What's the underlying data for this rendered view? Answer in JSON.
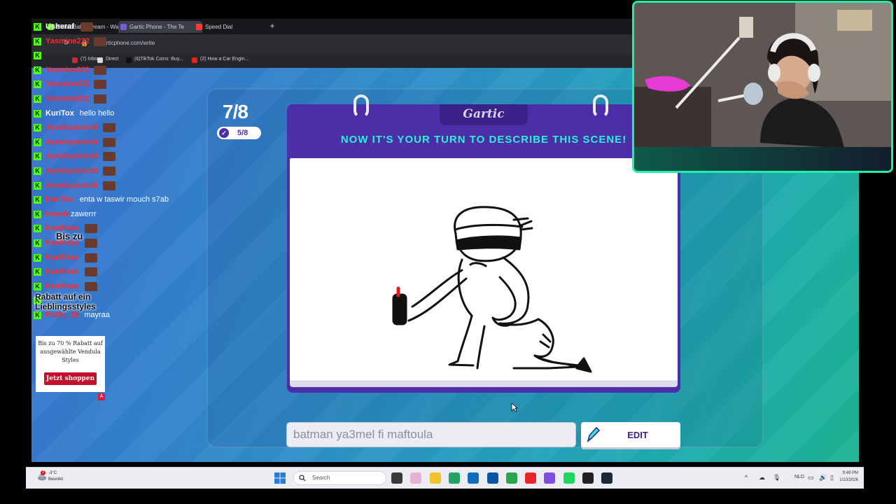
{
  "browser": {
    "tabs": [
      {
        "label": "EvilishBaby Stream - Watc",
        "color": "#53fc18",
        "active": false
      },
      {
        "label": "Gartic Phone - The Te",
        "color": "#7b5bd6",
        "active": true
      },
      {
        "label": "Speed Dial",
        "color": "#ff3b3b",
        "active": false
      }
    ],
    "new_tab": "+",
    "url": "garticphone.com/write",
    "bookmarks": [
      {
        "label": "(7) Inbox",
        "color": "#c03030"
      },
      {
        "label": "Direct",
        "color": "#d9d9d9"
      },
      {
        "label": "(6)TikTok Coins: Buy...",
        "color": "#111111"
      },
      {
        "label": "(2) How a Car Engin...",
        "color": "#e62117"
      }
    ]
  },
  "game": {
    "round": "7/8",
    "done_count": "5/8",
    "logo": "Gartic",
    "prompt": "NOW IT'S YOUR TURN TO DESCRIBE THIS SCENE!",
    "answer": "batman ya3mel fi maftoula",
    "edit_label": "EDIT",
    "brand_color": "#4b2ea8",
    "prompt_color": "#2ef0d8"
  },
  "chat": {
    "messages": [
      {
        "user": "Usheraf",
        "color": "#ffffff",
        "text": "",
        "emotes": 1
      },
      {
        "user": "Yasmine222",
        "color": "#ff2a2a",
        "text": "",
        "emotes": 1
      },
      {
        "user": "",
        "color": "#ff2a2a",
        "text": "",
        "emotes": 0
      },
      {
        "user": "Yasmine222",
        "color": "#ff2a2a",
        "text": "",
        "emotes": 1
      },
      {
        "user": "Yasmine222",
        "color": "#ff2a2a",
        "text": "",
        "emotes": 1
      },
      {
        "user": "Yasmine222",
        "color": "#ff2a2a",
        "text": "",
        "emotes": 1
      },
      {
        "user": "KuriTox",
        "color": "#ffffff",
        "text": "hello hello",
        "emotes": 0
      },
      {
        "user": "Ayoubyacoubi",
        "color": "#ff2a2a",
        "text": "",
        "emotes": 1
      },
      {
        "user": "Ayoubyacoubi",
        "color": "#ff2a2a",
        "text": "",
        "emotes": 1
      },
      {
        "user": "Ayoubyacoubi",
        "color": "#ff2a2a",
        "text": "",
        "emotes": 1
      },
      {
        "user": "Ayoubyacoubi",
        "color": "#ff2a2a",
        "text": "",
        "emotes": 1
      },
      {
        "user": "Ayoubyacoubi",
        "color": "#ff2a2a",
        "text": "",
        "emotes": 1
      },
      {
        "user": "KuriTox",
        "color": "#ff2a2a",
        "text": "enta w taswir mouch s7ab",
        "emotes": 0
      },
      {
        "user": "Haach",
        "color": "#ff2a2a",
        "text": "zawerrr",
        "emotes": 0
      },
      {
        "user": "Kardhiaa",
        "color": "#ff2a2a",
        "text": "",
        "emotes": 1
      },
      {
        "user": "Kardhiaa",
        "color": "#ff2a2a",
        "text": "",
        "emotes": 1
      },
      {
        "user": "Kardhiaa",
        "color": "#ff2a2a",
        "text": "",
        "emotes": 1
      },
      {
        "user": "Kardhiaa",
        "color": "#ff2a2a",
        "text": "",
        "emotes": 1
      },
      {
        "user": "Kardhiaa",
        "color": "#ff2a2a",
        "text": "",
        "emotes": 1
      },
      {
        "user": "",
        "color": "#ff2a2a",
        "text": "",
        "emotes": 0
      },
      {
        "user": "Pablo_1k",
        "color": "#ff2a2a",
        "text": "mayraa",
        "emotes": 0
      }
    ],
    "badge_letter": "K",
    "badge_color": "#53fc18"
  },
  "ad": {
    "overlay_text": "Bis zu",
    "overlay_text_2": "Rabatt auf ein",
    "overlay_text_3": "Lieblingsstyles",
    "text": "Bis zu 70 % Rabatt auf ausgewählte Vendula Styles",
    "button": "Jetzt shoppen",
    "flag": "A"
  },
  "taskbar": {
    "weather_temp": "-3°C",
    "weather_condition": "Bewolkt",
    "weather_badge": "2",
    "search": "Search",
    "language": "NLD",
    "time": "9:49 PM",
    "date": "1/10/2026",
    "apps": [
      "#3a3a3a",
      "#e7b1d6",
      "#f2c12e",
      "#21a366",
      "#0f6cbd",
      "#0b56a4",
      "#2aa44f",
      "#e8262a",
      "#7d4ee0",
      "#1ed760",
      "#222222",
      "#1b2838"
    ]
  }
}
